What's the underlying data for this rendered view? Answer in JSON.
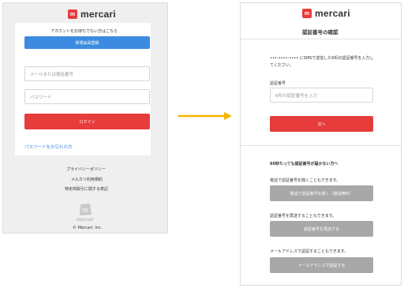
{
  "brand": {
    "logo_mark": "m",
    "logo_text": "mercari",
    "accent_color": "#e73c3c",
    "link_color": "#3c8be0"
  },
  "left": {
    "no_account_text": "アカウントをお持ちでない方はこちら",
    "signup_button": "新規会員登録",
    "identifier_placeholder": "メールまたは電話番号",
    "password_placeholder": "パスワード",
    "login_button": "ログイン",
    "forgot_password_link": "パスワードをお忘れの方",
    "footer_links": [
      "プライバシーポリシー",
      "メルカリ利用規約",
      "特定商取引に関する表記"
    ],
    "footer_logo_text": "mercari",
    "copyright": "© Mercari, Inc."
  },
  "right": {
    "page_title": "認証番号の確認",
    "sms_info": "•••-••••-•••• にSMSで送信した6桁の認証番号を入力してください。",
    "code_label": "認証番号",
    "code_placeholder": "6桁の認証番号を入力",
    "next_button": "次へ",
    "not_received_heading": "60秒たっても認証番号が届かない方へ",
    "phone_option_text": "電話で認証番号を聞くこともできます。",
    "phone_button": "電話で認証番号を聞く（通話無料）",
    "resend_option_text": "認証番号を再送することもできます。",
    "resend_button": "認証番号を再送する",
    "email_option_text": "メールアドレスで認証することもできます。",
    "email_button": "メールアドレスで認証する"
  }
}
